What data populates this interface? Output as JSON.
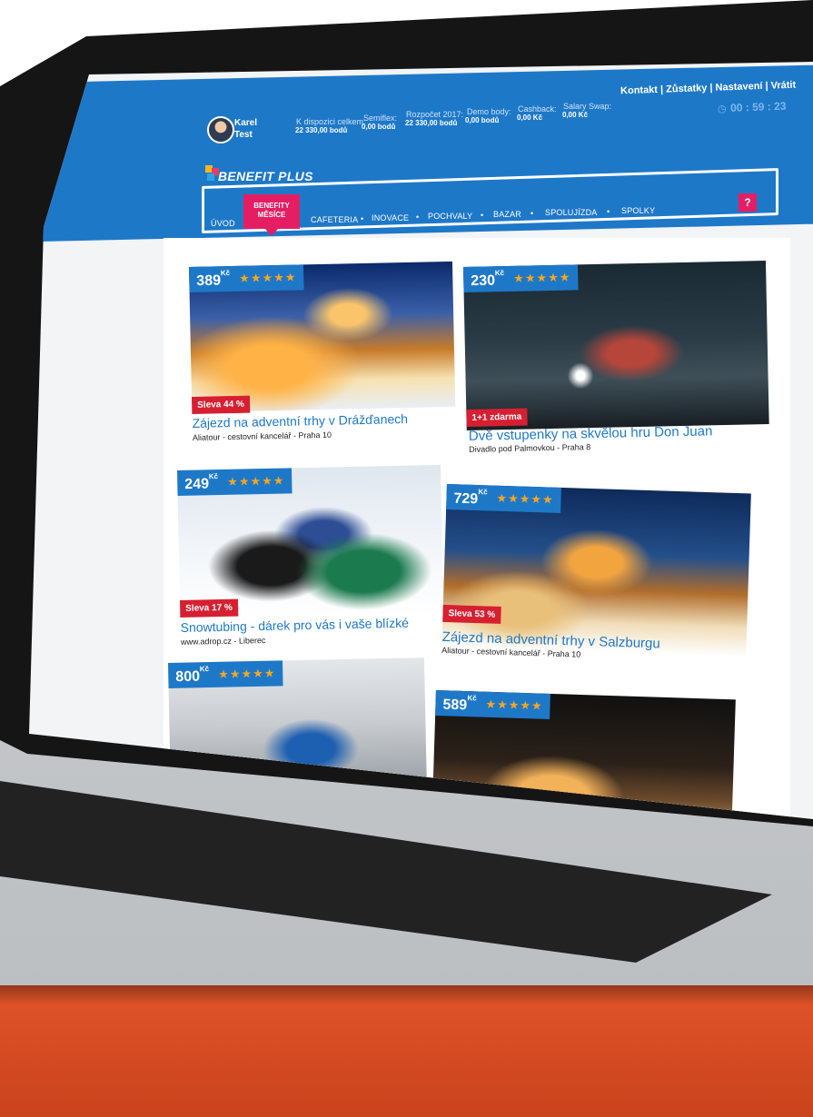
{
  "user": {
    "first_name": "Karel",
    "last_name": "Test"
  },
  "balances": [
    {
      "label": "K dispozici celkem:",
      "value": "22 330,00 bodů"
    },
    {
      "label": "Semiflex:",
      "value": "0,00 bodů"
    },
    {
      "label": "Rozpočet 2017:",
      "value": "22 330,00 bodů"
    },
    {
      "label": "Demo body:",
      "value": "0,00 bodů"
    },
    {
      "label": "Cashback:",
      "value": "0,00 Kč"
    },
    {
      "label": "Salary Swap:",
      "value": "0,00 Kč"
    }
  ],
  "top_links": "Kontakt | Zůstatky | Nastavení | Vrátit",
  "timer": "00 : 59 : 23",
  "logo": "BENEFIT PLUS",
  "nav": {
    "items": [
      "ÚVOD",
      "CAFETERIA",
      "INOVACE",
      "POCHVALY",
      "BAZAR",
      "SPOLUJÍZDA",
      "SPOLKY"
    ],
    "active": "BENEFITY MĚSÍCE",
    "separator": "•",
    "help": "?"
  },
  "currency": "Kč",
  "stars": "★★★★★",
  "offers": [
    {
      "price": "389",
      "badge": "Sleva 44 %",
      "title": "Zájezd na adventní trhy v Drážďanech",
      "subtitle": "Aliatour - cestovní kancelář - Praha 10"
    },
    {
      "price": "230",
      "badge": "1+1 zdarma",
      "title": "Dvě vstupenky na skvělou hru Don Juan",
      "subtitle": "Divadlo pod Palmovkou - Praha 8"
    },
    {
      "price": "249",
      "badge": "Sleva 17 %",
      "title": "Snowtubing - dárek pro vás i vaše blízké",
      "subtitle": "www.adrop.cz - Liberec"
    },
    {
      "price": "729",
      "badge": "Sleva 53 %",
      "title": "Zájezd na adventní trhy v Salzburgu",
      "subtitle": "Aliatour - cestovní kancelář - Praha 10"
    },
    {
      "price": "800",
      "badge": "",
      "title": "",
      "subtitle": ""
    },
    {
      "price": "589",
      "badge": "",
      "title": "",
      "subtitle": ""
    }
  ]
}
